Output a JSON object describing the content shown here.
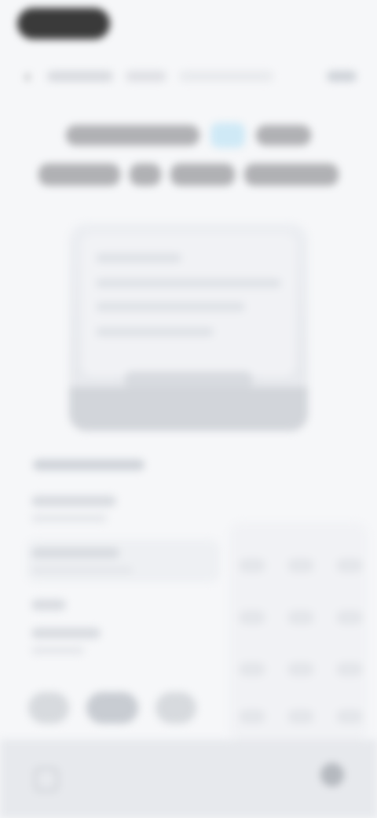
{
  "colors": {
    "background": "#f6f7f9",
    "accent_badge": "#cfe9f6"
  },
  "icons": {
    "back": "back-icon",
    "footer_left": "square-icon",
    "footer_right": "circle-icon"
  }
}
